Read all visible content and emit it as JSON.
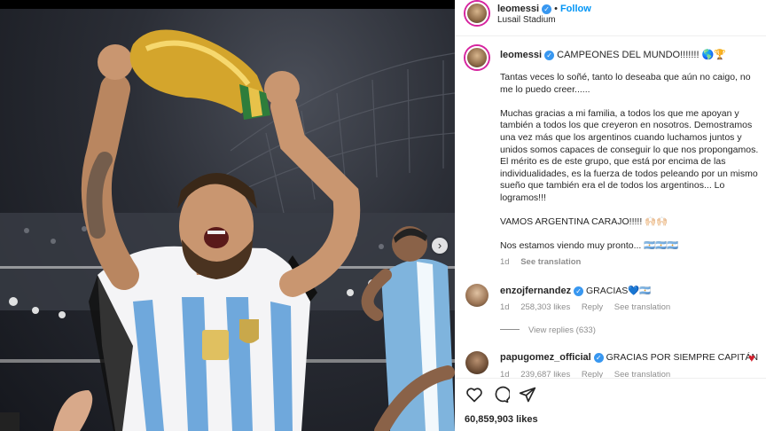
{
  "header": {
    "username": "leomessi",
    "separator": "•",
    "follow_label": "Follow",
    "location": "Lusail Stadium"
  },
  "caption": {
    "username": "leomessi",
    "headline": "CAMPEONES DEL MUNDO!!!!!!! 🌎🏆",
    "paragraphs": [
      "Tantas veces lo soñé, tanto lo deseaba que aún no caigo, no me lo puedo creer......",
      "Muchas gracias a mi familia, a todos los que me apoyan y también a todos los que creyeron en nosotros. Demostramos una vez más que los argentinos cuando luchamos juntos y unidos somos capaces de conseguir lo que nos propongamos. El mérito es de este grupo, que está por encima de las individualidades, es la fuerza de todos peleando por un mismo sueño que también era el de todos los argentinos... Lo logramos!!!",
      "VAMOS ARGENTINA CARAJO!!!!! 🙌🏻🙌🏻",
      "Nos estamos viendo muy pronto... 🇦🇷🇦🇷🇦🇷"
    ],
    "age": "1d",
    "see_translation": "See translation"
  },
  "comments": [
    {
      "username": "enzojfernandez",
      "text": "GRACIAS💙🇦🇷",
      "age": "1d",
      "likes": "258,303 likes",
      "reply": "Reply",
      "see_translation": "See translation"
    },
    {
      "username": "papugomez_official",
      "text": "GRACIAS POR SIEMPRE CAPITÁN",
      "age": "1d",
      "likes": "239,687 likes",
      "reply": "Reply",
      "see_translation": "See translation"
    }
  ],
  "view_replies": "View replies (633)",
  "likes_total": "60,859,903 likes",
  "colors": {
    "accent_blue": "#0095f6",
    "verified_blue": "#3897f0",
    "heart_red": "#d11e2c",
    "muted_gray": "#8e8e8e"
  },
  "icons": [
    "verified-badge-icon",
    "heart-icon",
    "comment-icon",
    "share-icon",
    "next-arrow-icon",
    "small-heart-icon"
  ]
}
